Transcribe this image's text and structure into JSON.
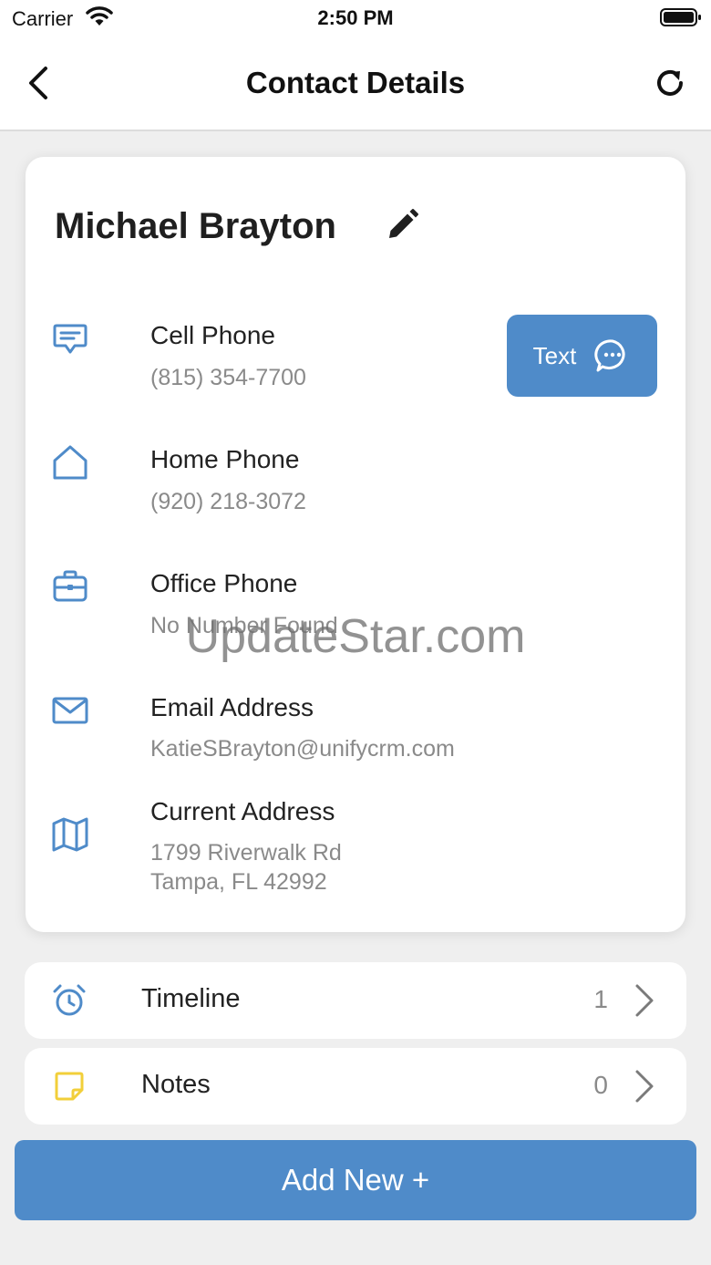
{
  "status_bar": {
    "carrier": "Carrier",
    "time": "2:50 PM"
  },
  "nav": {
    "title": "Contact Details",
    "back_icon": "chevron-left-icon",
    "refresh_icon": "refresh-icon"
  },
  "contact": {
    "name": "Michael Brayton",
    "rows": [
      {
        "icon": "message-icon",
        "label": "Cell Phone",
        "value": "(815) 354-7700"
      },
      {
        "icon": "home-icon",
        "label": "Home Phone",
        "value": "(920) 218-3072"
      },
      {
        "icon": "briefcase-icon",
        "label": "Office Phone",
        "value": "No Number Found"
      },
      {
        "icon": "mail-icon",
        "label": "Email Address",
        "value": "KatieSBrayton@unifycrm.com"
      },
      {
        "icon": "map-icon",
        "label": "Current Address",
        "value_line1": "1799 Riverwalk Rd",
        "value_line2": "Tampa, FL 42992"
      }
    ],
    "text_button": {
      "label": "Text",
      "icon": "chat-bubble-icon"
    }
  },
  "sections": [
    {
      "icon": "alarm-clock-icon",
      "label": "Timeline",
      "count": "1"
    },
    {
      "icon": "sticky-note-icon",
      "label": "Notes",
      "count": "0"
    }
  ],
  "add_button": {
    "label": "Add New +"
  },
  "watermark": "UpdateStar.com",
  "colors": {
    "accent": "#4f8bc9",
    "note_yellow": "#f2cf3a",
    "background": "#efefef"
  }
}
